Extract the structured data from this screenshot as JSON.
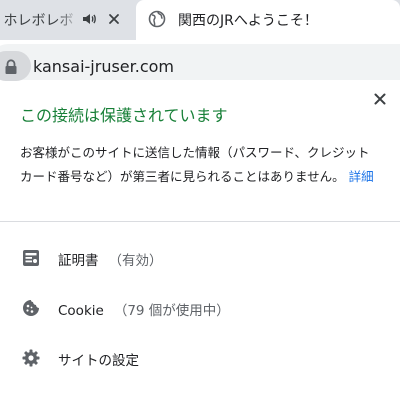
{
  "tabs": {
    "inactive": {
      "title": "- ホレボレボ"
    },
    "active": {
      "title": "関西のJRへようこそ！"
    }
  },
  "omnibox": {
    "url": "kansai-jruser.com"
  },
  "site_info": {
    "heading": "この接続は保護されています",
    "description": "お客様がこのサイトに送信した情報（パスワード、クレジット カード番号など）が第三者に見られることはありません。",
    "details_link": "詳細"
  },
  "items": [
    {
      "label": "証明書",
      "sub": "（有効）",
      "icon": "certificate-icon"
    },
    {
      "label": "Cookie",
      "sub": "（79 個が使用中）",
      "icon": "cookie-icon"
    },
    {
      "label": "サイトの設定",
      "sub": "",
      "icon": "gear-icon"
    }
  ],
  "colors": {
    "secure_green": "#188038",
    "link_blue": "#1a73e8",
    "tabstrip": "#dee1e6",
    "omnibox": "#f1f3f4"
  }
}
